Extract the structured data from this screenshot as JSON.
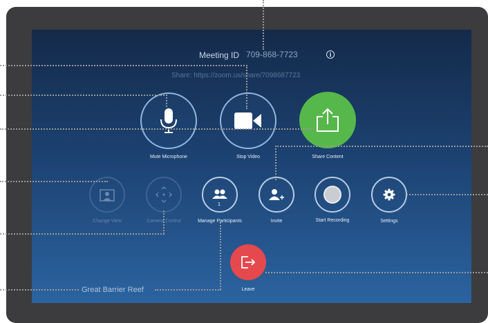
{
  "header": {
    "meeting_id_label": "Meeting ID",
    "meeting_id_value": "709-868-7723",
    "share_text": "Share: https://zoom.us/share/7098687723"
  },
  "controls": {
    "mute": "Mute Microphone",
    "stop_video": "Stop Video",
    "share_content": "Share Content",
    "change_view": "Change View",
    "camera_control": "Camera Control",
    "manage_participants": "Manage Participants",
    "participant_count": "1",
    "invite": "Invite",
    "start_recording": "Start Recording",
    "settings": "Settings",
    "leave": "Leave"
  },
  "room_name": "Great Barrier Reef",
  "colors": {
    "share": "#56b84a",
    "leave": "#e5484d",
    "screen_top": "#142a4a",
    "screen_bottom": "#2b63a0"
  }
}
